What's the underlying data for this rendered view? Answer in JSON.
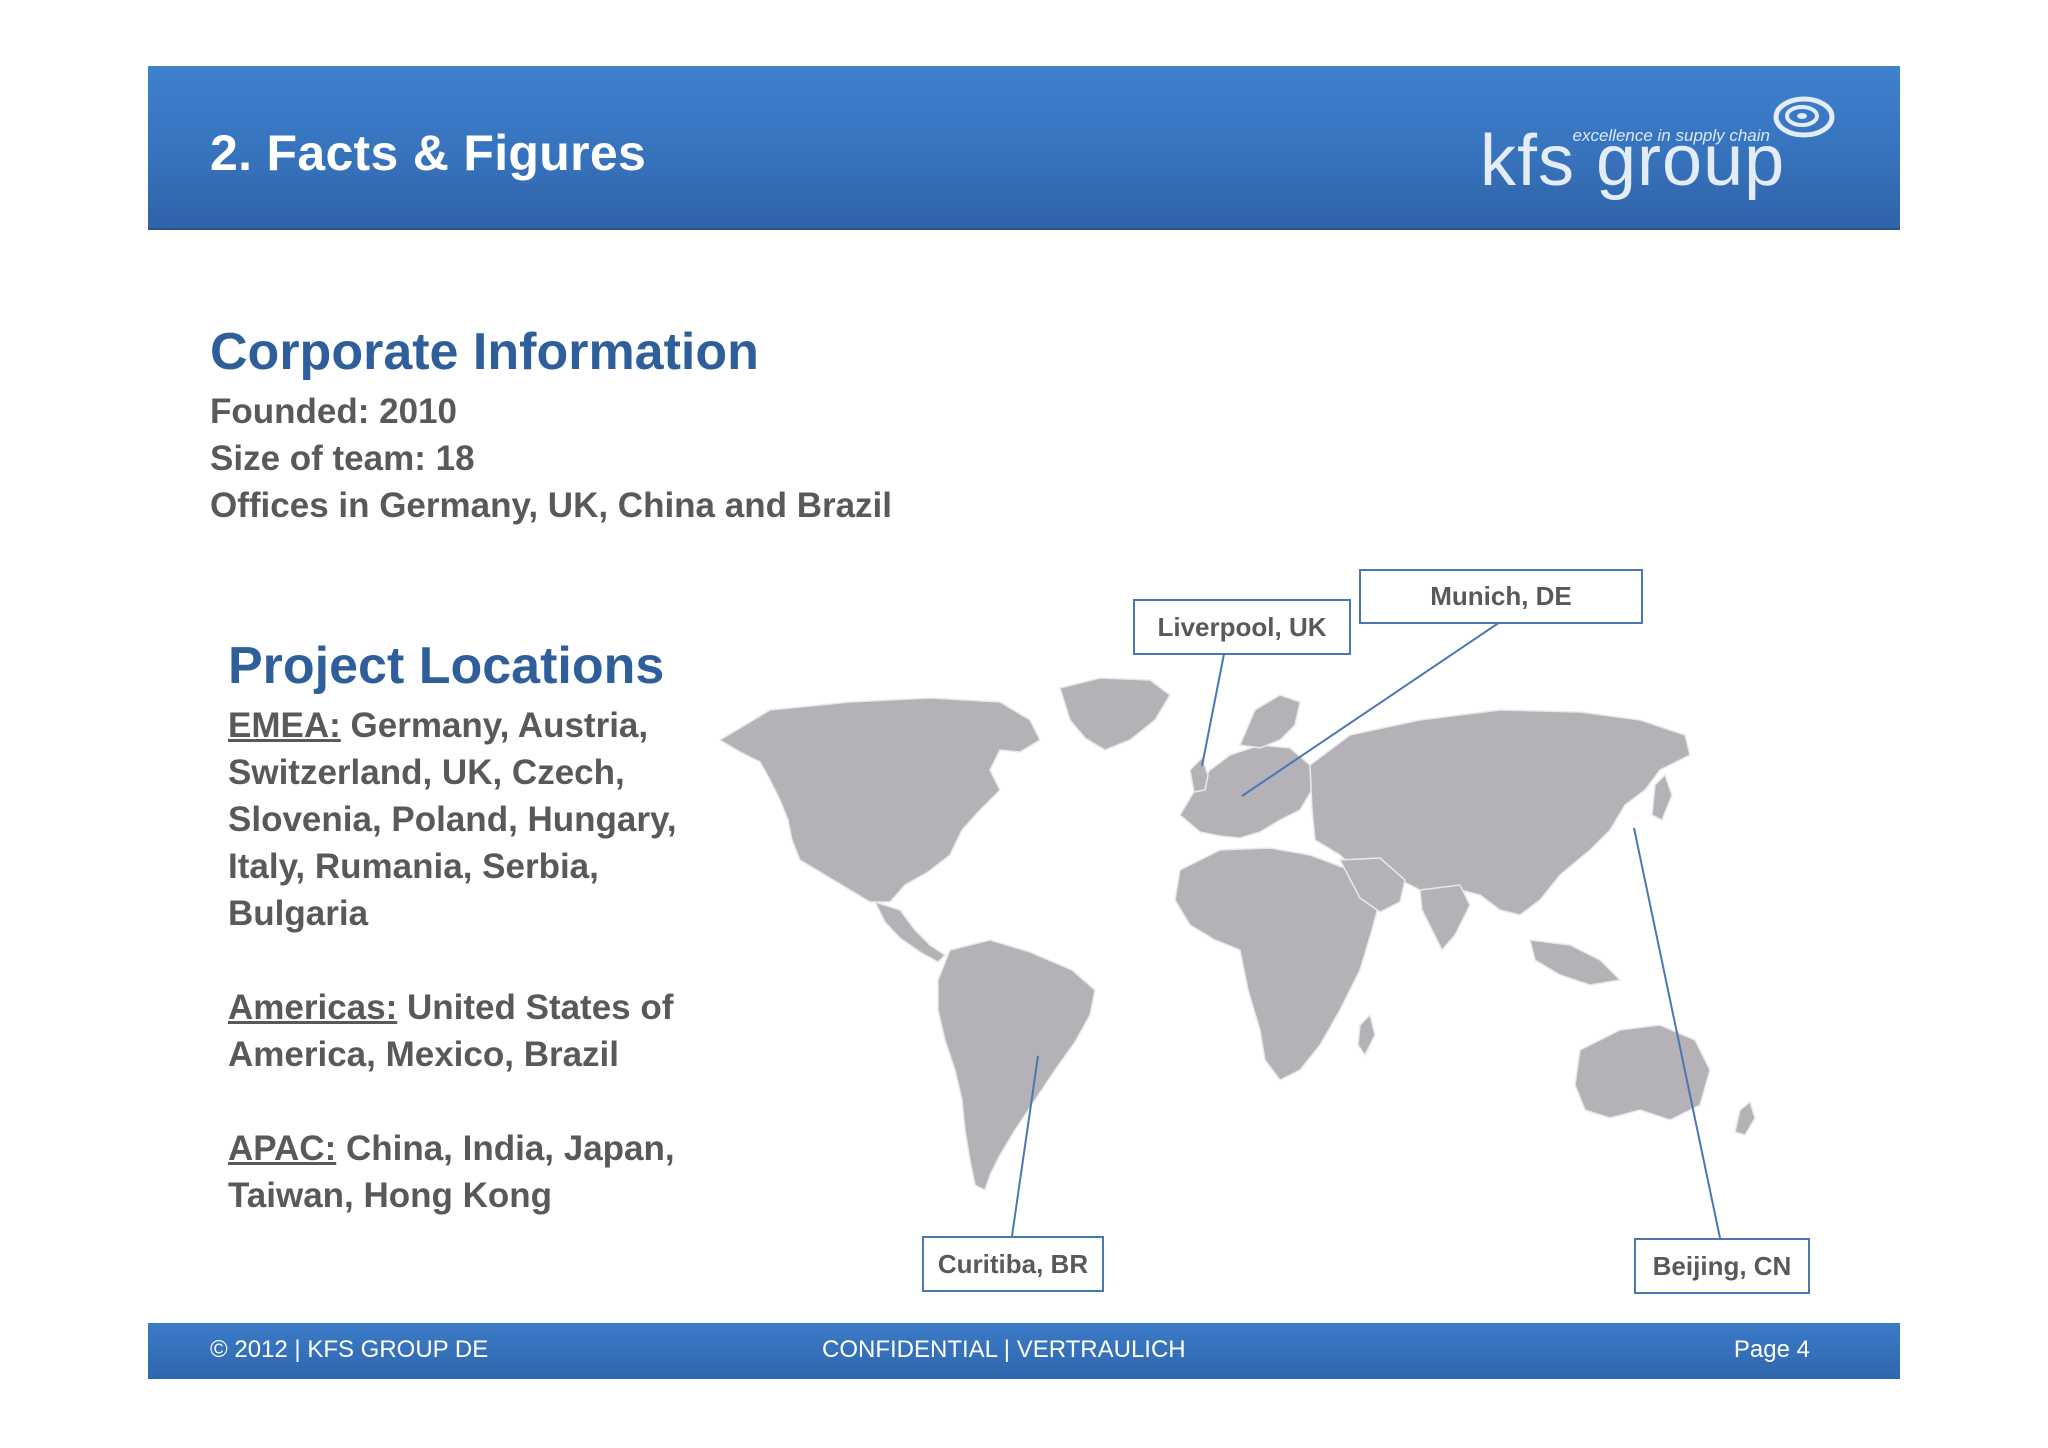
{
  "header": {
    "title": "2. Facts & Figures",
    "logo_tagline": "excellence in supply chain",
    "logo_word": "kfs group"
  },
  "corporate": {
    "heading": "Corporate Information",
    "lines": [
      "Founded: 2010",
      "Size of team: 18",
      "Offices in Germany, UK, China and Brazil"
    ]
  },
  "projects": {
    "heading": "Project Locations",
    "emea_label": "EMEA:",
    "emea_lines": [
      " Germany, Austria,",
      "Switzerland, UK, Czech,",
      "Slovenia, Poland, Hungary,",
      "Italy, Rumania, Serbia,",
      "Bulgaria"
    ],
    "americas_label": "Americas:",
    "americas_lines": [
      " United States of",
      "America, Mexico, Brazil"
    ],
    "apac_label": "APAC:",
    "apac_lines": [
      " China, India, Japan,",
      "Taiwan, Hong Kong"
    ]
  },
  "callouts": {
    "liverpool": "Liverpool, UK",
    "munich": "Munich, DE",
    "curitiba": "Curitiba, BR",
    "beijing": "Beijing, CN"
  },
  "footer": {
    "left": "© 2012 | KFS GROUP DE",
    "center": "CONFIDENTIAL | VERTRAULICH",
    "right": "Page 4"
  },
  "colors": {
    "header_blue": "#3773bd",
    "heading_blue": "#2f5f9b",
    "text_gray": "#595959",
    "map_gray": "#b4b2b6",
    "callout_border": "#4a77b4"
  }
}
